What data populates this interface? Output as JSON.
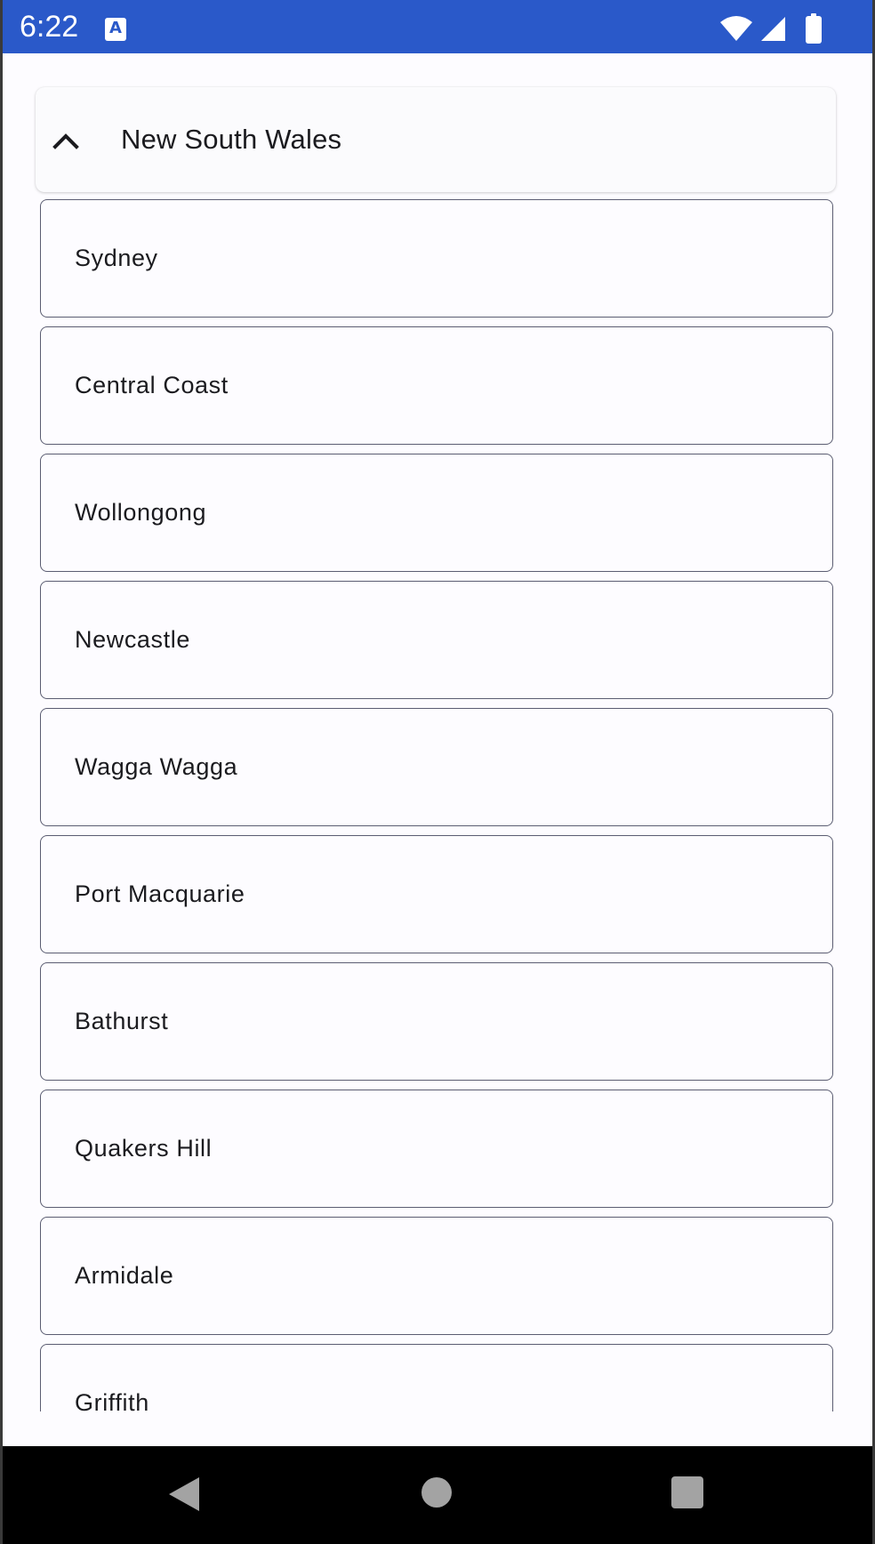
{
  "status_bar": {
    "time": "6:22",
    "app_icon_label": "A",
    "icons": [
      "wifi-icon",
      "signal-icon",
      "battery-icon"
    ],
    "background": "#2a59c9"
  },
  "accordion": {
    "title": "New South Wales",
    "expanded": true,
    "toggle_icon": "chevron-up-icon"
  },
  "cities": [
    "Sydney",
    "Central Coast",
    "Wollongong",
    "Newcastle",
    "Wagga Wagga",
    "Port Macquarie",
    "Bathurst",
    "Quakers Hill",
    "Armidale",
    "Griffith"
  ],
  "nav_bar": {
    "icons": [
      "back-icon",
      "home-icon",
      "recents-icon"
    ]
  },
  "colors": {
    "item_border": "#5b5d72",
    "text": "#1b1b1f"
  }
}
